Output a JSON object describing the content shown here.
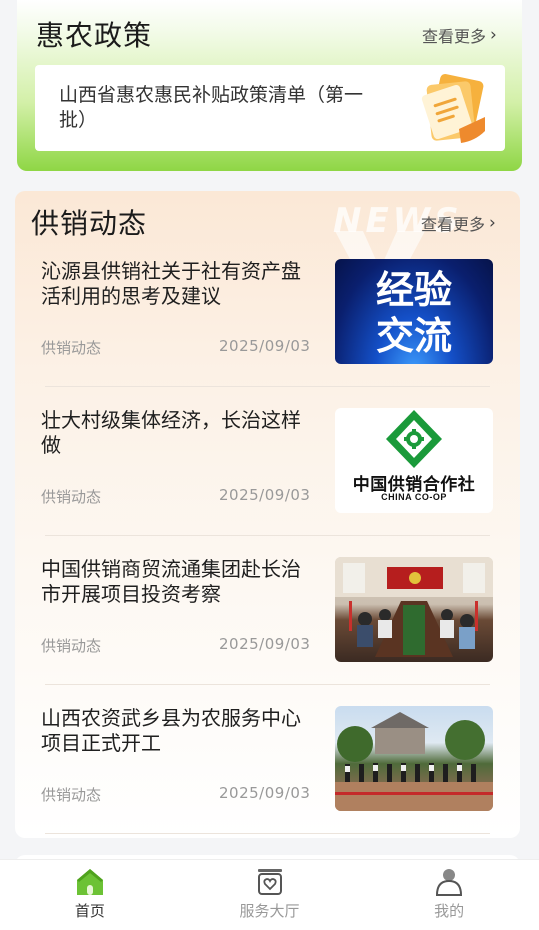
{
  "policy": {
    "title": "惠农政策",
    "more_label": "查看更多",
    "item_text": "山西省惠农惠民补贴政策清单（第一批）"
  },
  "news": {
    "title": "供销动态",
    "more_label": "查看更多",
    "watermark": "NEWS",
    "items": [
      {
        "title": "沁源县供销社关于社有资产盘活利用的思考及建议",
        "category": "供销动态",
        "date": "2025/09/03",
        "thumb_text_1": "经验",
        "thumb_text_2": "交流"
      },
      {
        "title": "壮大村级集体经济，长治这样做",
        "category": "供销动态",
        "date": "2025/09/03",
        "thumb_text_1": "中国供销合作社",
        "thumb_text_2": "CHINA CO-OP"
      },
      {
        "title": "中国供销商贸流通集团赴长治市开展项目投资考察",
        "category": "供销动态",
        "date": "2025/09/03"
      },
      {
        "title": "山西农资武乡县为农服务中心项目正式开工",
        "category": "供销动态",
        "date": "2025/09/03"
      }
    ]
  },
  "tabbar": {
    "tabs": [
      {
        "label": "首页",
        "icon": "home-icon",
        "active": true
      },
      {
        "label": "服务大厅",
        "icon": "service-hall-icon",
        "active": false
      },
      {
        "label": "我的",
        "icon": "profile-icon",
        "active": false
      }
    ]
  },
  "colors": {
    "accent_green": "#6cc235",
    "inactive_gray": "#999999"
  }
}
